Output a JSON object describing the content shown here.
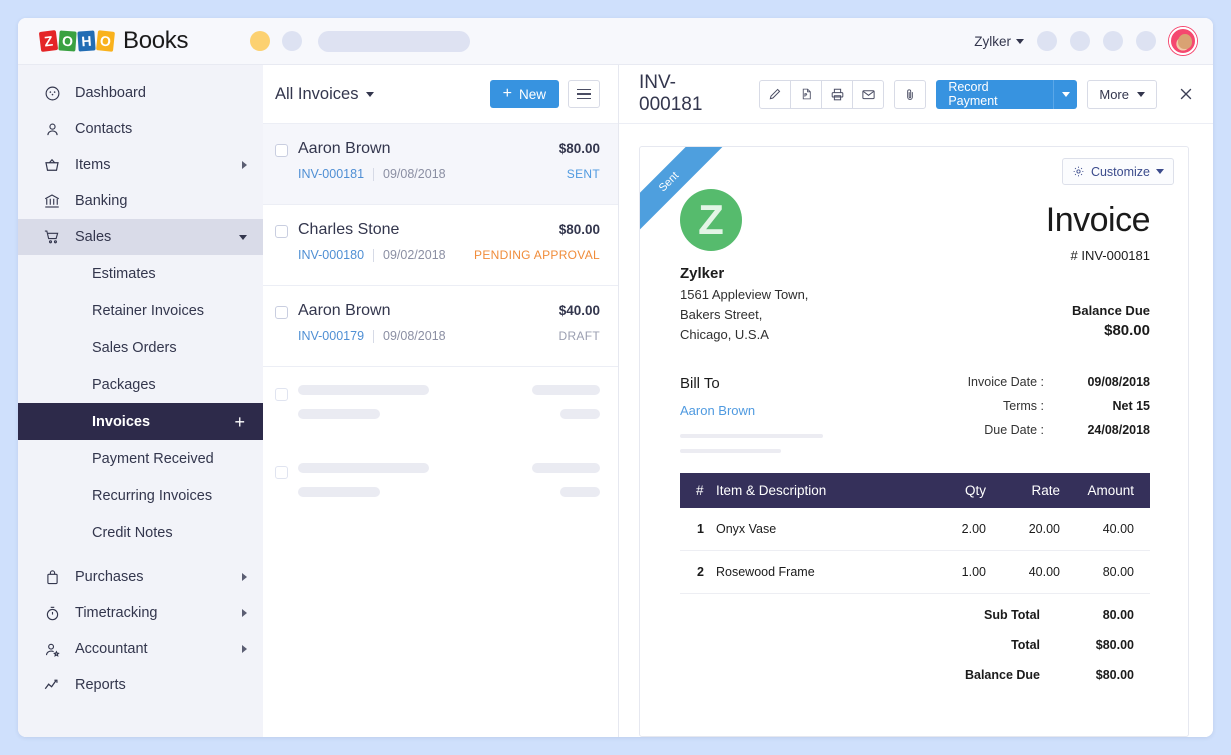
{
  "topbar": {
    "brand_name": "Books",
    "logo_letters": [
      "Z",
      "O",
      "H",
      "O"
    ],
    "org_name": "Zylker",
    "search_placeholder": ""
  },
  "sidebar": {
    "items": [
      {
        "label": "Dashboard",
        "icon": "dashboard-icon",
        "arrow": "none"
      },
      {
        "label": "Contacts",
        "icon": "contacts-icon",
        "arrow": "none"
      },
      {
        "label": "Items",
        "icon": "items-basket-icon",
        "arrow": "right"
      },
      {
        "label": "Banking",
        "icon": "bank-icon",
        "arrow": "none"
      },
      {
        "label": "Sales",
        "icon": "cart-icon",
        "arrow": "down",
        "open": true
      },
      {
        "label": "Purchases",
        "icon": "bag-icon",
        "arrow": "right"
      },
      {
        "label": "Timetracking",
        "icon": "timer-icon",
        "arrow": "right"
      },
      {
        "label": "Accountant",
        "icon": "accountant-icon",
        "arrow": "right"
      },
      {
        "label": "Reports",
        "icon": "reports-icon",
        "arrow": "none"
      }
    ],
    "sales_children": [
      {
        "label": "Estimates",
        "active": false
      },
      {
        "label": "Retainer Invoices",
        "active": false
      },
      {
        "label": "Sales Orders",
        "active": false
      },
      {
        "label": "Packages",
        "active": false
      },
      {
        "label": "Invoices",
        "active": true,
        "add_label": "+"
      },
      {
        "label": "Payment Received",
        "active": false
      },
      {
        "label": "Recurring Invoices",
        "active": false
      },
      {
        "label": "Credit Notes",
        "active": false
      }
    ]
  },
  "list_pane": {
    "filter_label": "All Invoices",
    "new_button": "New",
    "invoices": [
      {
        "customer": "Aaron Brown",
        "amount": "$80.00",
        "number": "INV-000181",
        "date": "09/08/2018",
        "status": "SENT",
        "status_kind": "sent",
        "selected": true
      },
      {
        "customer": "Charles Stone",
        "amount": "$80.00",
        "number": "INV-000180",
        "date": "09/02/2018",
        "status": "PENDING APPROVAL",
        "status_kind": "pending",
        "selected": false
      },
      {
        "customer": "Aaron Brown",
        "amount": "$40.00",
        "number": "INV-000179",
        "date": "09/08/2018",
        "status": "DRAFT",
        "status_kind": "draft",
        "selected": false
      }
    ],
    "placeholder_rows": 2
  },
  "detail": {
    "title": "INV-000181",
    "toolbar_icons": [
      "edit-pencil-icon",
      "pdf-file-icon",
      "print-icon",
      "email-icon",
      "attachment-icon"
    ],
    "record_payment_label": "Record Payment",
    "more_label": "More",
    "close_label": "close-icon"
  },
  "invoice": {
    "ribbon_label": "Sent",
    "customize_label": "Customize",
    "company": {
      "logo_letter": "Z",
      "name": "Zylker",
      "address_lines": [
        "1561 Appleview Town,",
        "Bakers Street,",
        "Chicago, U.S.A"
      ]
    },
    "heading": "Invoice",
    "number": "# INV-000181",
    "balance_due_label": "Balance Due",
    "balance_due_value": "$80.00",
    "bill_to_label": "Bill To",
    "bill_to_name": "Aaron Brown",
    "meta": [
      {
        "key": "Invoice Date :",
        "value": "09/08/2018"
      },
      {
        "key": "Terms :",
        "value": "Net 15"
      },
      {
        "key": "Due Date :",
        "value": "24/08/2018"
      }
    ],
    "table": {
      "headers": {
        "num": "#",
        "desc": "Item & Description",
        "qty": "Qty",
        "rate": "Rate",
        "amount": "Amount"
      },
      "rows": [
        {
          "num": "1",
          "desc": "Onyx Vase",
          "qty": "2.00",
          "rate": "20.00",
          "amount": "40.00"
        },
        {
          "num": "2",
          "desc": "Rosewood Frame",
          "qty": "1.00",
          "rate": "40.00",
          "amount": "80.00"
        }
      ]
    },
    "totals": [
      {
        "key": "Sub Total",
        "value": "80.00"
      },
      {
        "key": "Total",
        "value": "$80.00"
      },
      {
        "key": "Balance Due",
        "value": "$80.00"
      }
    ]
  },
  "colors": {
    "page_background": "#cfe0fc",
    "sidebar_background": "#f2f3f9",
    "active_nav": "#2d2a4a",
    "primary_blue": "#3793e0",
    "table_header": "#35305a",
    "status_sent": "#4f9ae0",
    "status_pending": "#f08c3a",
    "status_draft": "#9a9eb0",
    "company_logo_green": "#56bb6d",
    "ribbon_blue": "#4e9fde"
  }
}
